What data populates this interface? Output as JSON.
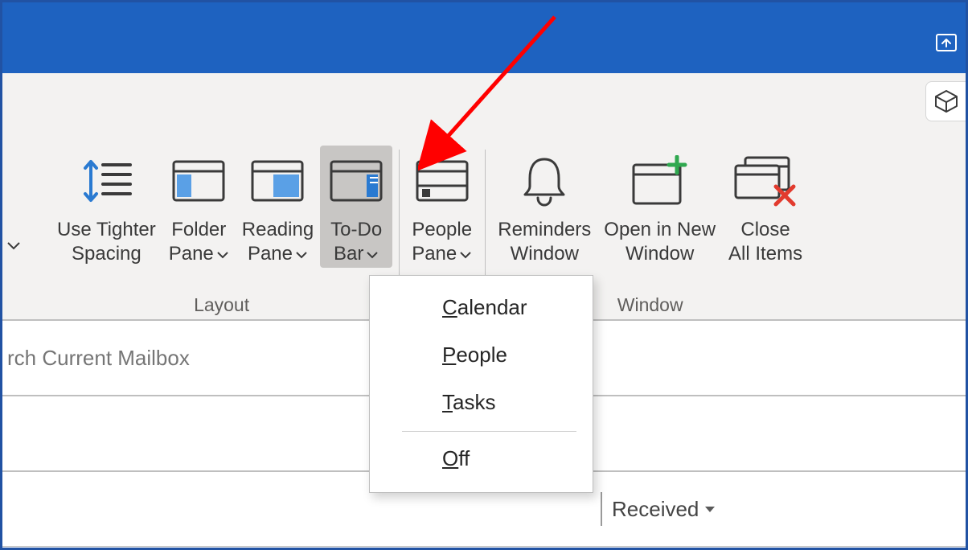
{
  "ribbon": {
    "groups": {
      "layout": {
        "label": "Layout",
        "commands": {
          "use_tighter_spacing": {
            "line1": "Use Tighter",
            "line2": "Spacing"
          },
          "folder_pane": {
            "line1": "Folder",
            "line2": "Pane"
          },
          "reading_pane": {
            "line1": "Reading",
            "line2": "Pane"
          },
          "to_do_bar": {
            "line1": "To-Do",
            "line2": "Bar"
          }
        }
      },
      "people_pane": {
        "commands": {
          "people_pane": {
            "line1": "People",
            "line2": "Pane"
          }
        }
      },
      "window": {
        "label": "Window",
        "commands": {
          "reminders_window": {
            "line1": "Reminders",
            "line2": "Window"
          },
          "open_in_new_window": {
            "line1": "Open in New",
            "line2": "Window"
          },
          "close_all_items": {
            "line1": "Close",
            "line2": "All Items"
          }
        }
      }
    }
  },
  "to_do_bar_menu": {
    "calendar": {
      "accel": "C",
      "rest": "alendar"
    },
    "people": {
      "accel": "P",
      "rest": "eople"
    },
    "tasks": {
      "accel": "T",
      "rest": "asks"
    },
    "off": {
      "accel": "O",
      "rest": "ff"
    }
  },
  "search": {
    "placeholder": "rch Current Mailbox"
  },
  "list_header": {
    "sort_by": "Received"
  }
}
